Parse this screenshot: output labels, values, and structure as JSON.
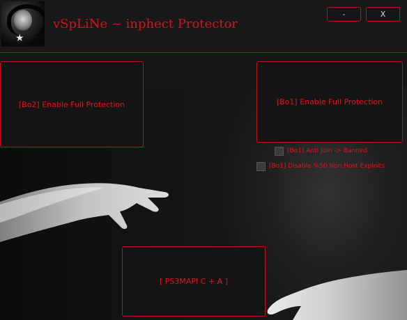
{
  "window": {
    "title": "vSpLiNe ~ inphect Protector",
    "minimize_label": "-",
    "close_label": "X"
  },
  "header": {
    "avatar_icon": "profile-photo-icon"
  },
  "buttons": {
    "bo2_full_protection": "[Bo2] Enable Full Protection",
    "bo1_full_protection": "[Bo1] Enable Full Protection",
    "ps3mapi": "[ PS3MAPI C + A ]"
  },
  "options": [
    {
      "label": "[Bo1] Anti Join -> Banned",
      "checked": false
    },
    {
      "label": "[Bo1] Disable %50 Non Host Exploits",
      "checked": false
    }
  ],
  "colors": {
    "accent": "#c0121a",
    "text_red": "#e2141c",
    "background": "#151515"
  }
}
